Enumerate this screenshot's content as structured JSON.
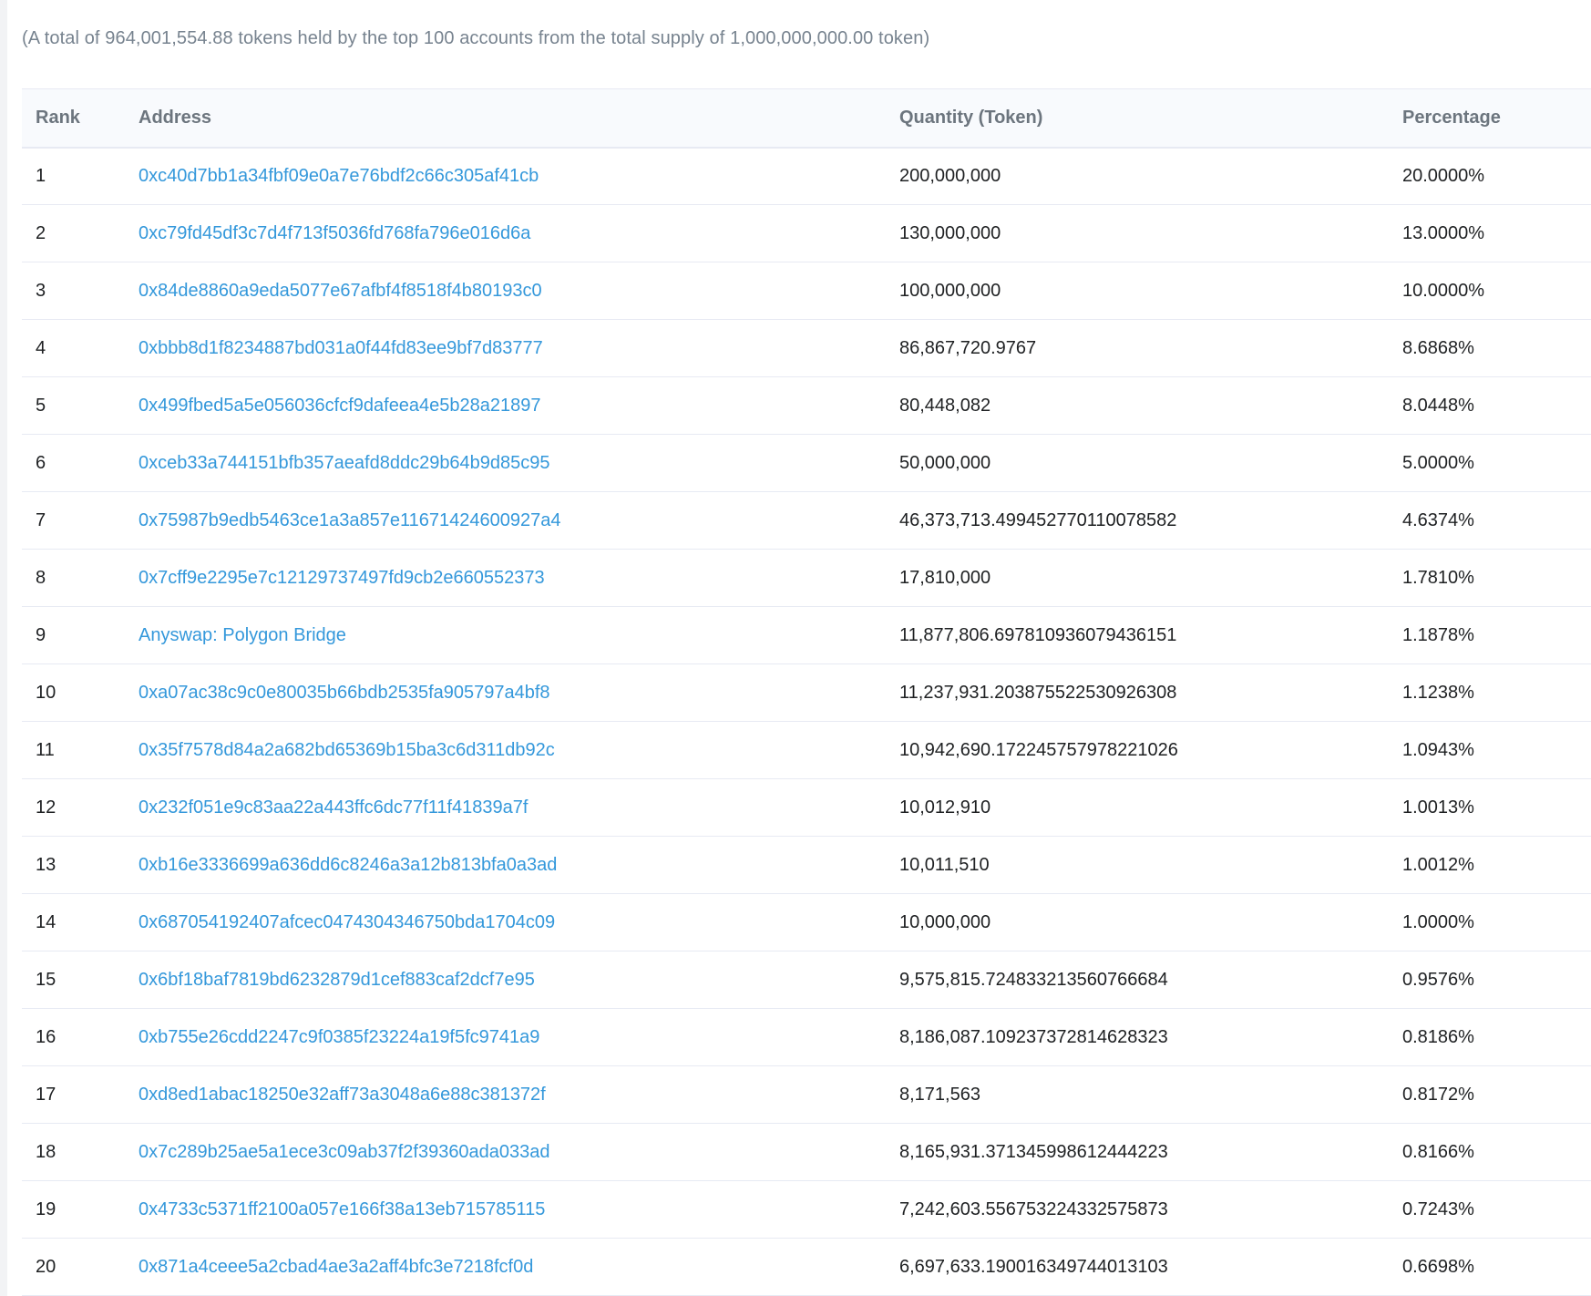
{
  "summary": "(A total of 964,001,554.88 tokens held by the top 100 accounts from the total supply of 1,000,000,000.00 token)",
  "table": {
    "headers": {
      "rank": "Rank",
      "address": "Address",
      "quantity": "Quantity (Token)",
      "percentage": "Percentage"
    },
    "rows": [
      {
        "rank": "1",
        "address": "0xc40d7bb1a34fbf09e0a7e76bdf2c66c305af41cb",
        "quantity": "200,000,000",
        "percentage": "20.0000%"
      },
      {
        "rank": "2",
        "address": "0xc79fd45df3c7d4f713f5036fd768fa796e016d6a",
        "quantity": "130,000,000",
        "percentage": "13.0000%"
      },
      {
        "rank": "3",
        "address": "0x84de8860a9eda5077e67afbf4f8518f4b80193c0",
        "quantity": "100,000,000",
        "percentage": "10.0000%"
      },
      {
        "rank": "4",
        "address": "0xbbb8d1f8234887bd031a0f44fd83ee9bf7d83777",
        "quantity": "86,867,720.9767",
        "percentage": "8.6868%"
      },
      {
        "rank": "5",
        "address": "0x499fbed5a5e056036cfcf9dafeea4e5b28a21897",
        "quantity": "80,448,082",
        "percentage": "8.0448%"
      },
      {
        "rank": "6",
        "address": "0xceb33a744151bfb357aeafd8ddc29b64b9d85c95",
        "quantity": "50,000,000",
        "percentage": "5.0000%"
      },
      {
        "rank": "7",
        "address": "0x75987b9edb5463ce1a3a857e11671424600927a4",
        "quantity": "46,373,713.499452770110078582",
        "percentage": "4.6374%"
      },
      {
        "rank": "8",
        "address": "0x7cff9e2295e7c12129737497fd9cb2e660552373",
        "quantity": "17,810,000",
        "percentage": "1.7810%"
      },
      {
        "rank": "9",
        "address": "Anyswap: Polygon Bridge",
        "quantity": "11,877,806.697810936079436151",
        "percentage": "1.1878%"
      },
      {
        "rank": "10",
        "address": "0xa07ac38c9c0e80035b66bdb2535fa905797a4bf8",
        "quantity": "11,237,931.203875522530926308",
        "percentage": "1.1238%"
      },
      {
        "rank": "11",
        "address": "0x35f7578d84a2a682bd65369b15ba3c6d311db92c",
        "quantity": "10,942,690.172245757978221026",
        "percentage": "1.0943%"
      },
      {
        "rank": "12",
        "address": "0x232f051e9c83aa22a443ffc6dc77f11f41839a7f",
        "quantity": "10,012,910",
        "percentage": "1.0013%"
      },
      {
        "rank": "13",
        "address": "0xb16e3336699a636dd6c8246a3a12b813bfa0a3ad",
        "quantity": "10,011,510",
        "percentage": "1.0012%"
      },
      {
        "rank": "14",
        "address": "0x687054192407afcec0474304346750bda1704c09",
        "quantity": "10,000,000",
        "percentage": "1.0000%"
      },
      {
        "rank": "15",
        "address": "0x6bf18baf7819bd6232879d1cef883caf2dcf7e95",
        "quantity": "9,575,815.724833213560766684",
        "percentage": "0.9576%"
      },
      {
        "rank": "16",
        "address": "0xb755e26cdd2247c9f0385f23224a19f5fc9741a9",
        "quantity": "8,186,087.109237372814628323",
        "percentage": "0.8186%"
      },
      {
        "rank": "17",
        "address": "0xd8ed1abac18250e32aff73a3048a6e88c381372f",
        "quantity": "8,171,563",
        "percentage": "0.8172%"
      },
      {
        "rank": "18",
        "address": "0x7c289b25ae5a1ece3c09ab37f2f39360ada033ad",
        "quantity": "8,165,931.371345998612444223",
        "percentage": "0.8166%"
      },
      {
        "rank": "19",
        "address": "0x4733c5371ff2100a057e166f38a13eb715785115",
        "quantity": "7,242,603.556753224332575873",
        "percentage": "0.7243%"
      },
      {
        "rank": "20",
        "address": "0x871a4ceee5a2cbad4ae3a2aff4bfc3e7218fcf0d",
        "quantity": "6,697,633.190016349744013103",
        "percentage": "0.6698%"
      }
    ]
  },
  "colors": {
    "link": "#3498db",
    "muted_text": "#77838f",
    "header_text": "#6c757e",
    "header_bg": "#f8fafd",
    "border": "#e7eaf3"
  }
}
